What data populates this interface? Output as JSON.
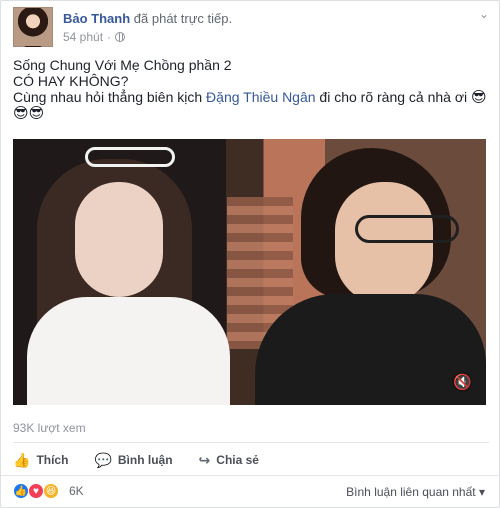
{
  "post": {
    "author": "Bảo Thanh",
    "action_text": "đã phát trực tiếp.",
    "timestamp": "54 phút",
    "text_line1": "Sống Chung Với Mẹ Chồng phần 2",
    "text_line2": "CÓ HAY KHÔNG?",
    "text_line3_prefix": "Cùng nhau hỏi thẳng biên kịch ",
    "mention": "Đặng Thiều Ngân",
    "text_line3_suffix": " đi cho rõ ràng cả nhà ơi ",
    "emojis_line3": "😎",
    "emojis_line4": "😎😎"
  },
  "video": {
    "views": "93K lượt xem",
    "mute_icon": "speaker-muted-icon"
  },
  "actions": {
    "like": "Thích",
    "comment": "Bình luận",
    "share": "Chia sẻ"
  },
  "reactions": {
    "count": "6K",
    "icons": [
      "like-reaction-icon",
      "love-reaction-icon",
      "haha-reaction-icon"
    ]
  },
  "comments": {
    "sort_label": "Bình luận liên quan nhất"
  },
  "colors": {
    "facebook_blue": "#365899",
    "meta_gray": "#90949c",
    "action_gray": "#4b4f56"
  }
}
